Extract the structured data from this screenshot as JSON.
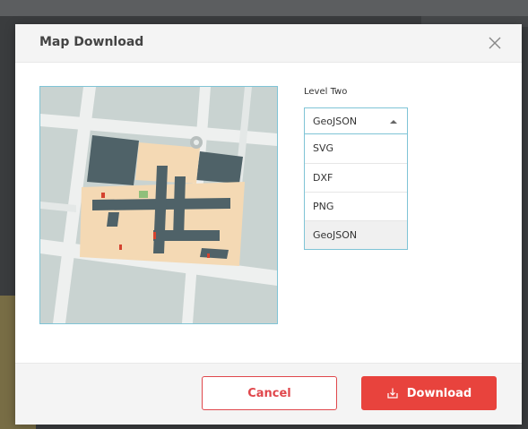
{
  "dialog": {
    "title": "Map Download",
    "close_icon": "close-icon"
  },
  "map_preview": {
    "description_icon": "floor-plan-map"
  },
  "level": {
    "label": "Level Two"
  },
  "format_select": {
    "selected": "GeoJSON",
    "expanded": true,
    "options": [
      "SVG",
      "DXF",
      "PNG",
      "GeoJSON"
    ]
  },
  "footer": {
    "cancel_label": "Cancel",
    "download_label": "Download",
    "download_icon": "download-icon"
  },
  "colors": {
    "accent_red": "#e8433d",
    "select_border": "#7fc4d6"
  }
}
